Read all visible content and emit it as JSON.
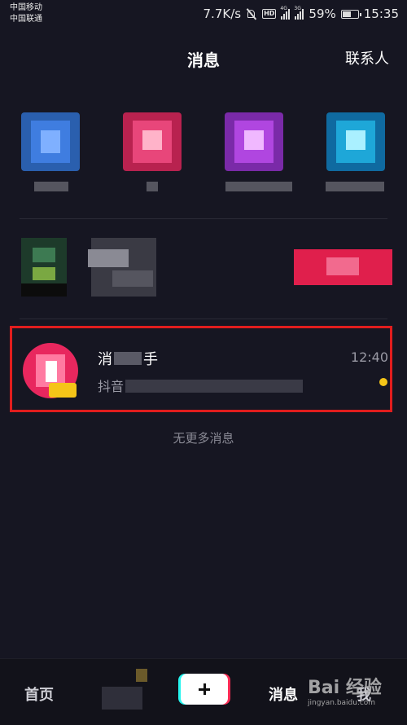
{
  "status_bar": {
    "carrier_1": "中国移动",
    "carrier_2": "中国联通",
    "speed": "7.7K/s",
    "hd": "HD",
    "net_1": "4G",
    "net_2": "3G",
    "battery": "59%",
    "battery_level": 0.59,
    "time": "15:35"
  },
  "header": {
    "title": "消息",
    "contacts": "联系人"
  },
  "message": {
    "name_part1": "消",
    "name_part2": "手",
    "preview": "抖音",
    "time": "12:40"
  },
  "no_more": "无更多消息",
  "nav": {
    "home": "首页",
    "messages": "消息",
    "me": "我"
  },
  "watermark": {
    "brand": "Bai 经验",
    "site": "jingyan.baidu.com"
  },
  "colors": {
    "background": "#161622",
    "highlight": "#e11d1d",
    "unread": "#f5c518"
  }
}
